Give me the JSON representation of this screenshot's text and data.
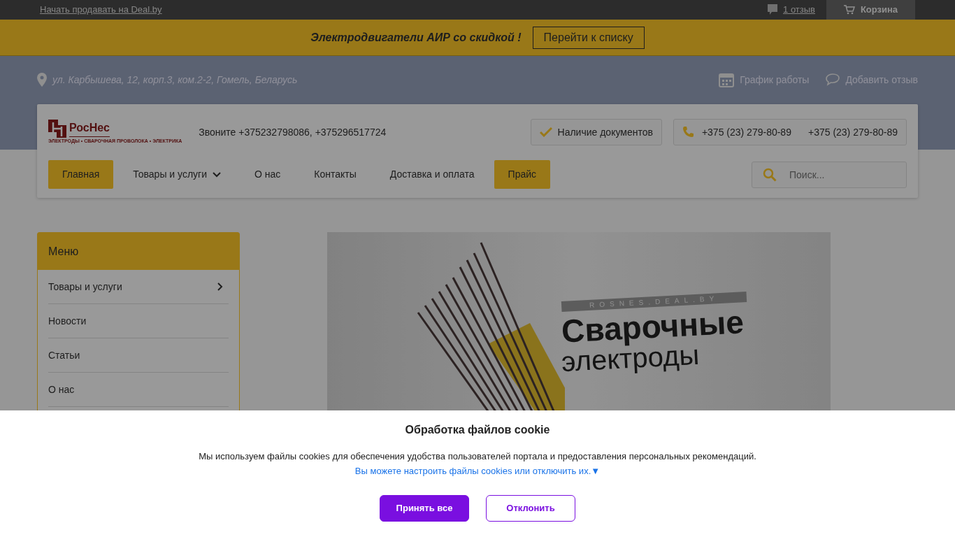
{
  "top_bar": {
    "sell_link": "Начать продавать на Deal.by",
    "reviews_link": "1 отзыв",
    "cart": "Корзина"
  },
  "promo": {
    "text": "Электродвигатели АИР  со скидкой !",
    "button": "Перейти к списку"
  },
  "info_bar": {
    "address": "ул. Карбышева, 12, корп.3, ком.2-2, Гомель, Беларусь",
    "schedule": "График работы",
    "add_review": "Добавить отзыв"
  },
  "header": {
    "logo": "РосНес",
    "logo_tagline": "ЭЛЕКТРОДЫ • СВАРОЧНАЯ ПРОВОЛОКА • ЭЛЕКТРИКА",
    "call_text": "Звоните +375232798086, +375296517724",
    "documents": "Наличие документов",
    "phones": [
      "+375 (23) 279-80-89",
      "+375 (23) 279-80-89"
    ]
  },
  "nav": [
    {
      "label": "Главная",
      "kind": "highlight"
    },
    {
      "label": "Товары и услуги",
      "kind": "dropdown"
    },
    {
      "label": "О нас",
      "kind": "plain"
    },
    {
      "label": "Контакты",
      "kind": "plain"
    },
    {
      "label": "Доставка и оплата",
      "kind": "plain"
    },
    {
      "label": "Прайс",
      "kind": "highlight"
    }
  ],
  "search": {
    "placeholder": "Поиск..."
  },
  "sidebar": {
    "title": "Меню",
    "items": [
      {
        "label": "Товары и услуги",
        "has_submenu": true
      },
      {
        "label": "Новости",
        "has_submenu": false
      },
      {
        "label": "Статьи",
        "has_submenu": false
      },
      {
        "label": "О нас",
        "has_submenu": false
      }
    ]
  },
  "banner": {
    "tag": "ROSNES.DEAL.BY",
    "title": "Сварочные",
    "subtitle": "электроды"
  },
  "cookie": {
    "title": "Обработка файлов cookie",
    "text": "Мы используем файлы cookies для обеспечения удобства пользователей портала и предоставления персональных рекомендаций.",
    "settings_link": "Вы можете настроить файлы cookies или отключить их.▼",
    "buttons": [
      {
        "label": "Принять все",
        "kind": "primary"
      },
      {
        "label": "Отклонить",
        "kind": "outline"
      }
    ]
  }
}
